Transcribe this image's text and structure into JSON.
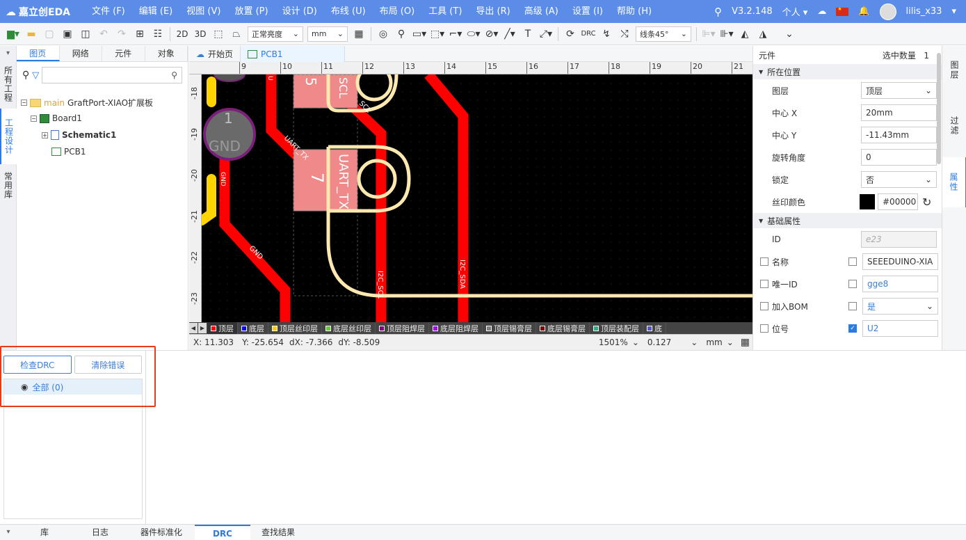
{
  "app": {
    "logo": "嘉立创EDA",
    "version": "V3.2.148",
    "mode": "个人",
    "username": "lilis_x33"
  },
  "menu": [
    "文件 (F)",
    "编辑 (E)",
    "视图 (V)",
    "放置 (P)",
    "设计 (D)",
    "布线 (U)",
    "布局 (O)",
    "工具 (T)",
    "导出 (R)",
    "高级 (A)",
    "设置 (I)",
    "帮助 (H)"
  ],
  "toolbar": {
    "btn_2d": "2D",
    "btn_3d": "3D",
    "brightness": "正常亮度",
    "unit": "mm",
    "drc_label": "DRC",
    "line_angle": "线条45°"
  },
  "left_vtabs": [
    "所有工程",
    "工程设计",
    "常用库"
  ],
  "left_tabs": [
    "图页",
    "网络",
    "元件",
    "对象"
  ],
  "tree": {
    "root_tag": "main",
    "root": "GraftPort-XIAO扩展板",
    "board": "Board1",
    "schematic": "Schematic1",
    "pcb": "PCB1"
  },
  "doc_tabs": [
    "开始页",
    "PCB1"
  ],
  "ruler_top": [
    "9",
    "10",
    "11",
    "12",
    "13",
    "14",
    "15",
    "16",
    "17",
    "18",
    "19",
    "20",
    "21"
  ],
  "ruler_left": [
    "-18",
    "-19",
    "-20",
    "-21",
    "-22",
    "-23"
  ],
  "pcb_labels": {
    "pad1_num": "1",
    "pad1_name": "GND",
    "pad7_num": "7",
    "pad7_name": "UART_TX",
    "net_uart": "UART_TX",
    "net_gnd": "GND",
    "net_gnd2": "GND",
    "net_scl1": "I2C_SCL",
    "net_scl2": "SCL",
    "net_sda": "I2C_SDA",
    "pad_top_num": "5",
    "pad_top_name": "SCL",
    "net_u": "U"
  },
  "layers": [
    {
      "name": "顶层",
      "color": "#ff0000"
    },
    {
      "name": "底层",
      "color": "#0000ff"
    },
    {
      "name": "顶层丝印层",
      "color": "#ffcc00"
    },
    {
      "name": "底层丝印层",
      "color": "#66cc33"
    },
    {
      "name": "顶层阻焊层",
      "color": "#800080"
    },
    {
      "name": "底层阻焊层",
      "color": "#aa00ff"
    },
    {
      "name": "顶层锡膏层",
      "color": "#808080"
    },
    {
      "name": "底层锡膏层",
      "color": "#800000"
    },
    {
      "name": "顶层装配层",
      "color": "#33aa88"
    },
    {
      "name": "底",
      "color": "#5555cc"
    }
  ],
  "status": {
    "x": "X:  11.303",
    "y": "Y:  -25.654",
    "dx": "dX:  -7.366",
    "dy": "dY:  -8.509",
    "zoom": "1501%",
    "grid": "0.127",
    "unit": "mm"
  },
  "right": {
    "title": "元件",
    "sel_count_label": "选中数量",
    "sel_count": "1",
    "sec_position": "所在位置",
    "layer_label": "图层",
    "layer_val": "顶层",
    "cx_label": "中心 X",
    "cx_val": "20mm",
    "cy_label": "中心 Y",
    "cy_val": "-11.43mm",
    "rot_label": "旋转角度",
    "rot_val": "0",
    "lock_label": "锁定",
    "lock_val": "否",
    "silk_label": "丝印颜色",
    "silk_val": "#00000",
    "sec_basic": "基础属性",
    "id_label": "ID",
    "id_val": "e23",
    "name_label": "名称",
    "name_val": "SEEEDUINO-XIA",
    "uid_label": "唯一ID",
    "uid_val": "gge8",
    "bom_label": "加入BOM",
    "bom_val": "是",
    "des_label": "位号",
    "des_val": "U2"
  },
  "right_vtabs": [
    "图层",
    "过滤",
    "属性"
  ],
  "drc": {
    "check_btn": "检查DRC",
    "clear_btn": "清除错误",
    "all_item": "全部 (0)"
  },
  "bottom_tabs": [
    "库",
    "日志",
    "器件标准化",
    "DRC",
    "查找结果"
  ]
}
